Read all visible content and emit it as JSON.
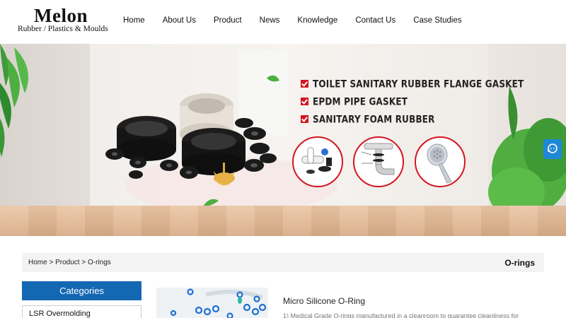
{
  "brand": {
    "name": "Melon",
    "tagline": "Rubber / Plastics & Moulds",
    "accent_color": "#d3161f"
  },
  "nav": {
    "items": [
      {
        "label": "Home"
      },
      {
        "label": "About Us"
      },
      {
        "label": "Product"
      },
      {
        "label": "News"
      },
      {
        "label": "Knowledge"
      },
      {
        "label": "Contact Us"
      },
      {
        "label": "Case Studies"
      }
    ]
  },
  "banner": {
    "bullets": [
      "TOILET SANITARY RUBBER FLANGE GASKET",
      "EPDM PIPE GASKET",
      "SANITARY FOAM RUBBER"
    ]
  },
  "side_widget": {
    "icon": "chat-icon",
    "color": "#1e88d6"
  },
  "breadcrumb": {
    "home": "Home",
    "sep": ">",
    "product": "Product",
    "current": "O-rings",
    "page_title": "O-rings"
  },
  "categories": {
    "heading": "Categories",
    "header_color": "#1467b3",
    "items": [
      "LSR Overmolding"
    ]
  },
  "product": {
    "title": "Micro Silicone O-Ring",
    "description": "1)  Medical Grade O-rings manufactured in a cleanroom to guarantee cleanliness for"
  }
}
